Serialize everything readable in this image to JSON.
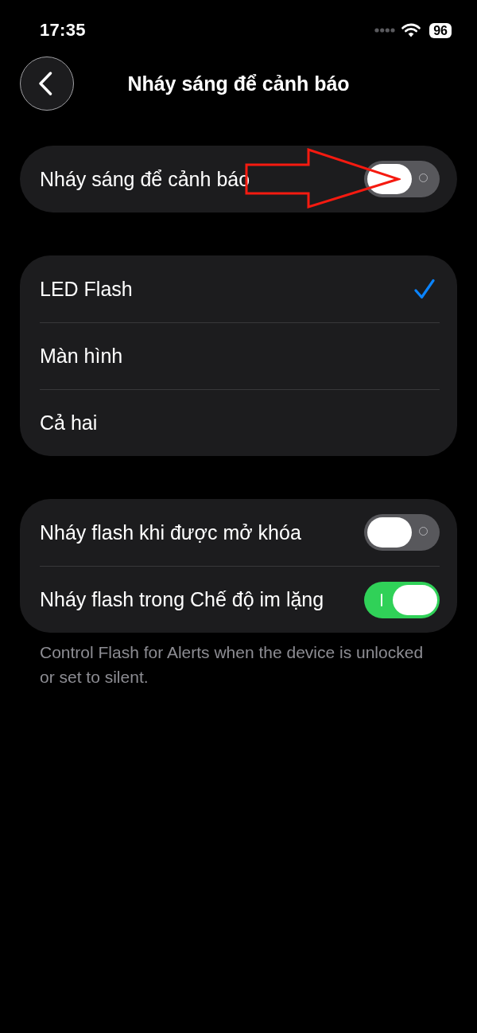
{
  "status_bar": {
    "time": "17:35",
    "battery": "96"
  },
  "header": {
    "title": "Nháy sáng để cảnh báo"
  },
  "main_toggle": {
    "label": "Nháy sáng để cảnh báo",
    "on": false
  },
  "flash_options": [
    {
      "label": "LED Flash",
      "selected": true
    },
    {
      "label": "Màn hình",
      "selected": false
    },
    {
      "label": "Cả hai",
      "selected": false
    }
  ],
  "conditions": [
    {
      "label": "Nháy flash khi được mở khóa",
      "on": false
    },
    {
      "label": "Nháy flash trong Chế độ im lặng",
      "on": true
    }
  ],
  "footer_note": "Control Flash for Alerts when the device is unlocked or set to silent.",
  "annotations": [
    {
      "kind": "arrow"
    }
  ]
}
